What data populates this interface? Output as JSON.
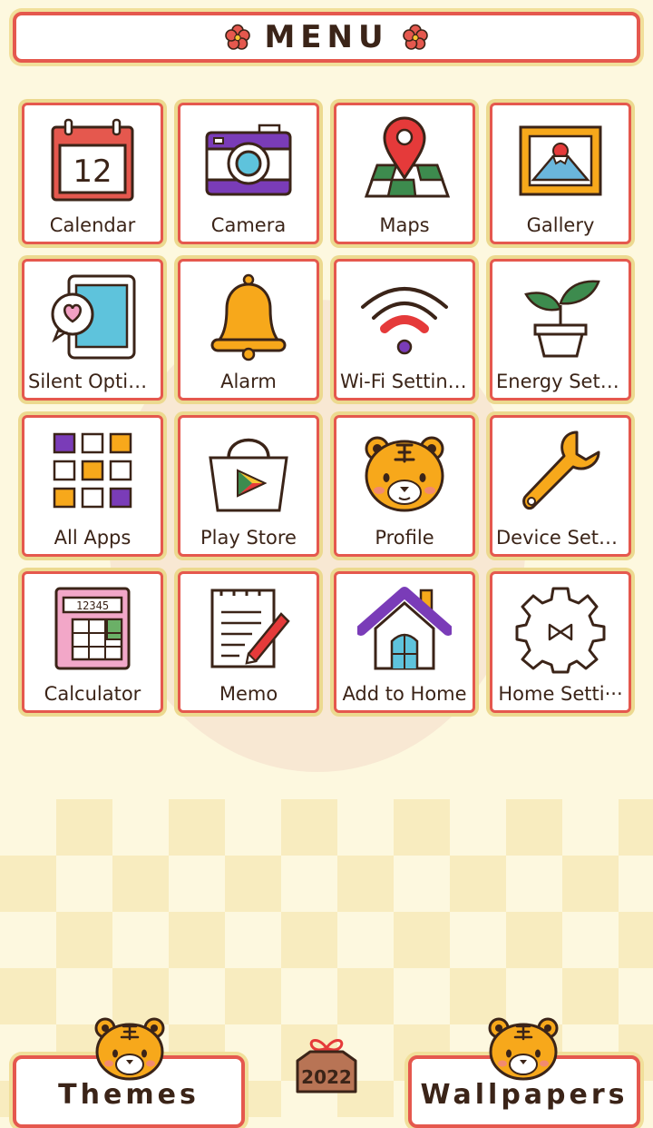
{
  "header": {
    "title": "MENU",
    "icon_left": "flower-icon",
    "icon_right": "flower-icon"
  },
  "apps": [
    {
      "label": "Calendar",
      "icon": "calendar-icon",
      "date": "12"
    },
    {
      "label": "Camera",
      "icon": "camera-icon"
    },
    {
      "label": "Maps",
      "icon": "map-pin-icon"
    },
    {
      "label": "Gallery",
      "icon": "picture-frame-icon"
    },
    {
      "label": "Silent Options",
      "icon": "tablet-heart-icon"
    },
    {
      "label": "Alarm",
      "icon": "bell-icon"
    },
    {
      "label": "Wi-Fi Settings",
      "icon": "wifi-icon"
    },
    {
      "label": "Energy Setti···",
      "icon": "plant-icon"
    },
    {
      "label": "All Apps",
      "icon": "app-grid-icon"
    },
    {
      "label": "Play Store",
      "icon": "shopping-bag-icon"
    },
    {
      "label": "Profile",
      "icon": "tiger-face-icon"
    },
    {
      "label": "Device Setti···",
      "icon": "wrench-icon"
    },
    {
      "label": "Calculator",
      "icon": "calculator-icon",
      "display": "12345"
    },
    {
      "label": "Memo",
      "icon": "memo-pencil-icon"
    },
    {
      "label": "Add to Home",
      "icon": "house-icon"
    },
    {
      "label": "Home Setti···",
      "icon": "gear-icon"
    }
  ],
  "bottom": {
    "themes_label": "Themes",
    "wallpapers_label": "Wallpapers",
    "year_tag": "2022"
  },
  "colors": {
    "accent_red": "#e5584e",
    "gold_outline": "#ecd98f",
    "background": "#fdf8df",
    "ink": "#3b2418",
    "purple": "#7a3cb8",
    "orange": "#f7a81b"
  }
}
